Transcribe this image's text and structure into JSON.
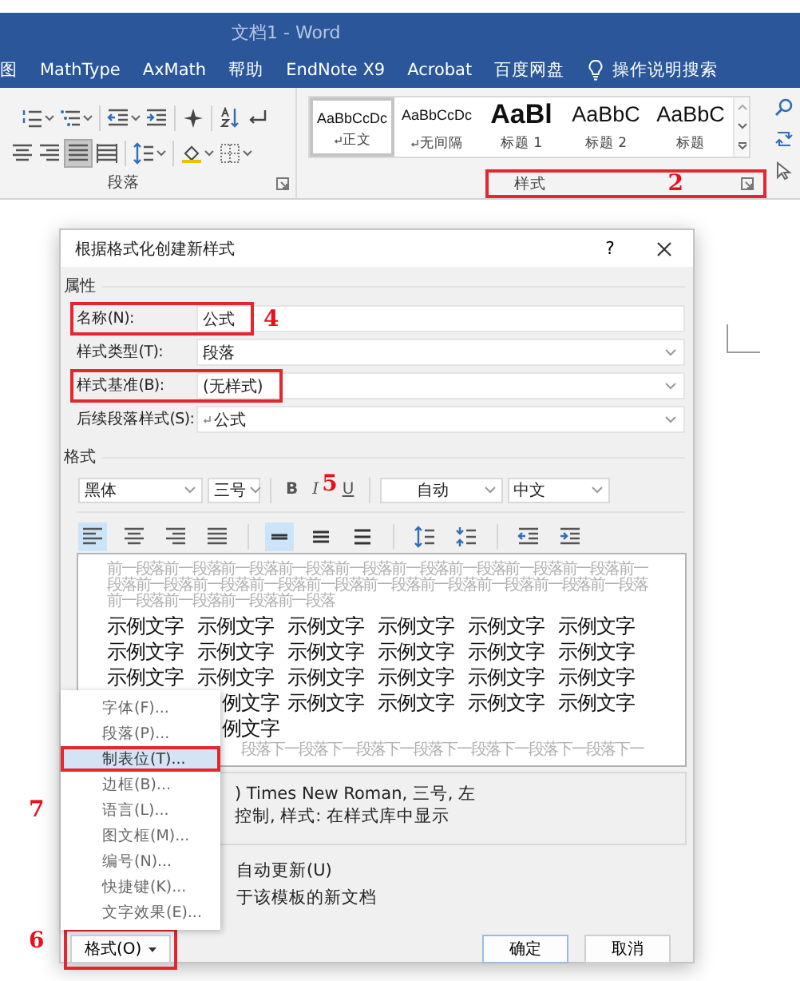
{
  "window": {
    "title": "文档1 - Word"
  },
  "menu_tabs": [
    {
      "label": "图",
      "kind": "tab"
    },
    {
      "label": "MathType",
      "kind": "tab"
    },
    {
      "label": "AxMath",
      "kind": "tab"
    },
    {
      "label": "帮助",
      "kind": "tab"
    },
    {
      "label": "EndNote X9",
      "kind": "tab"
    },
    {
      "label": "Acrobat",
      "kind": "tab"
    },
    {
      "label": "百度网盘",
      "kind": "tab"
    },
    {
      "label": "操作说明搜索",
      "kind": "search"
    }
  ],
  "ribbon": {
    "paragraph": {
      "label": "段落",
      "tools_row1": [
        {
          "kind": "numbering"
        },
        {
          "kind": "multilevel"
        },
        {
          "kind": "decrease-indent"
        },
        {
          "kind": "increase-indent"
        },
        {
          "kind": "asian-layout"
        },
        {
          "kind": "sort"
        },
        {
          "kind": "show-marks"
        }
      ],
      "alignment_buttons": [
        {
          "kind": "align-center",
          "selected": false
        },
        {
          "kind": "align-right",
          "selected": false
        },
        {
          "kind": "justify",
          "selected": true
        },
        {
          "kind": "distributed",
          "selected": false
        }
      ],
      "tools_row2": [
        {
          "kind": "line-spacing"
        },
        {
          "kind": "shading"
        },
        {
          "kind": "borders"
        }
      ]
    },
    "styles": {
      "label": "样式",
      "highlighted": true,
      "annotation": "2",
      "items": [
        {
          "preview": "AaBbCcDc",
          "name": "正文",
          "kind": "normal",
          "selected": true
        },
        {
          "preview": "AaBbCcDc",
          "name": "无间隔",
          "kind": "normal",
          "selected": false
        },
        {
          "preview": "AaBl",
          "name": "标题 1",
          "kind": "heading1",
          "selected": false
        },
        {
          "preview": "AaBbC",
          "name": "标题 2",
          "kind": "heading",
          "selected": false
        },
        {
          "preview": "AaBbC",
          "name": "标题",
          "kind": "heading",
          "selected": false
        }
      ]
    }
  },
  "dialog": {
    "title": "根据格式化创建新样式",
    "help": "?",
    "properties": {
      "heading": "属性",
      "rows": [
        {
          "label": "名称(N):",
          "value": "公式",
          "kind": "text",
          "paragraph_mark": false,
          "highlighted": true,
          "annotation": "4"
        },
        {
          "label": "样式类型(T):",
          "value": "段落",
          "kind": "dropdown",
          "paragraph_mark": false,
          "highlighted": false
        },
        {
          "label": "样式基准(B):",
          "value": "(无样式)",
          "kind": "dropdown",
          "paragraph_mark": false,
          "highlighted": true
        },
        {
          "label": "后续段落样式(S):",
          "value": "公式",
          "kind": "dropdown",
          "paragraph_mark": true,
          "highlighted": false
        }
      ]
    },
    "format": {
      "heading": "格式",
      "font": "黑体",
      "size": "三号",
      "bold": "B",
      "italic": "I",
      "underline": "U",
      "annotation": "5",
      "text_color": "自动",
      "language": "中文",
      "paragraph_buttons": [
        [
          {
            "kind": "align-left",
            "selected": true
          },
          {
            "kind": "align-center",
            "selected": false
          },
          {
            "kind": "align-right",
            "selected": false
          },
          {
            "kind": "justify",
            "selected": false
          }
        ],
        [
          {
            "kind": "single-spacing",
            "selected": true
          },
          {
            "kind": "one-half-spacing",
            "selected": false
          },
          {
            "kind": "double-spacing",
            "selected": false
          }
        ],
        [
          {
            "kind": "increase-spacing"
          },
          {
            "kind": "decrease-spacing"
          }
        ],
        [
          {
            "kind": "decrease-indent"
          },
          {
            "kind": "increase-indent"
          }
        ]
      ],
      "preview": {
        "previous_text": "前一段落前一段落前一段落前一段落前一段落前一段落前一段落前一段落前一段落前一段落前一段落前一段落前一段落前一段落前一段落前一段落前一段落前一段落前一段落前一段落前一段落前一段落前一段落",
        "sample_rows": [
          {
            "cut_start": false,
            "words": [
              "示例文字",
              "示例文字",
              "示例文字",
              "示例文字",
              "示例文字",
              "示例文字"
            ]
          },
          {
            "cut_start": false,
            "words": [
              "示例文字",
              "示例文字",
              "示例文字",
              "示例文字",
              "示例文字",
              "示例文字"
            ]
          },
          {
            "cut_start": false,
            "words": [
              "示例文字",
              "示例文字",
              "示例文字",
              "示例文字",
              "示例文字",
              "示例文字"
            ]
          },
          {
            "cut_start": true,
            "words": [
              "例文字",
              "示例文字",
              "示例文字",
              "示例文字",
              "示例文字"
            ]
          },
          {
            "cut_start": true,
            "words": [
              "例文字"
            ]
          }
        ],
        "next_text": "段落下一段落下一段落下一段落下一段落下一段落下一段落下一"
      },
      "description": [
        ") Times New Roman, 三号, 左",
        "控制, 样式: 在样式库中显示"
      ]
    },
    "options": [
      {
        "label": "自动更新(U)"
      },
      {
        "label": "于该模板的新文档"
      }
    ],
    "format_button": {
      "label": "格式(O)",
      "highlighted": true,
      "annotation": "6"
    },
    "buttons": [
      "确定",
      "取消"
    ],
    "format_menu": [
      {
        "label": "字体(F)...",
        "selected": false,
        "highlighted": false
      },
      {
        "label": "段落(P)...",
        "selected": false,
        "highlighted": false
      },
      {
        "label": "制表位(T)...",
        "selected": true,
        "highlighted": true,
        "annotation": "7"
      },
      {
        "label": "边框(B)...",
        "selected": false,
        "highlighted": false
      },
      {
        "label": "语言(L)...",
        "selected": false,
        "highlighted": false
      },
      {
        "label": "图文框(M)...",
        "selected": false,
        "highlighted": false
      },
      {
        "label": "编号(N)...",
        "selected": false,
        "highlighted": false
      },
      {
        "label": "快捷键(K)...",
        "selected": false,
        "highlighted": false
      },
      {
        "label": "文字效果(E)...",
        "selected": false,
        "highlighted": false
      }
    ]
  }
}
